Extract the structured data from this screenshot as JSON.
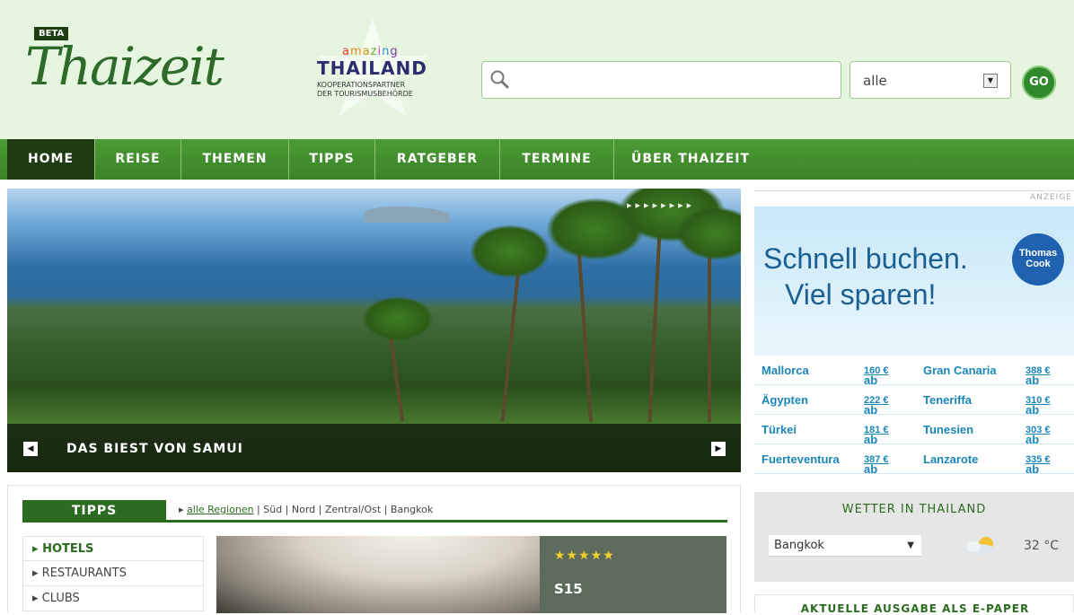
{
  "header": {
    "beta": "BETA",
    "logo": "Thaizeit",
    "amazing": {
      "letters": [
        {
          "ch": "a",
          "color": "#e53a2f"
        },
        {
          "ch": "m",
          "color": "#f08c1d"
        },
        {
          "ch": "a",
          "color": "#c49a12"
        },
        {
          "ch": "z",
          "color": "#6aa82c"
        },
        {
          "ch": "i",
          "color": "#e53a8f"
        },
        {
          "ch": "n",
          "color": "#2b8fd0"
        },
        {
          "ch": "g",
          "color": "#7b3aa6"
        }
      ],
      "thailand": "THAILAND",
      "coop_line1": "KOOPERATIONSPARTNER",
      "coop_line2": "DER TOURISMUSBEHÖRDE"
    },
    "search": {
      "value": "",
      "placeholder": ""
    },
    "region_select": "alle",
    "go": "GO"
  },
  "nav": {
    "items": [
      {
        "label": "HOME",
        "active": true
      },
      {
        "label": "REISE"
      },
      {
        "label": "THEMEN"
      },
      {
        "label": "TIPPS"
      },
      {
        "label": "RATGEBER"
      },
      {
        "label": "TERMINE"
      },
      {
        "label": "ÜBER THAIZEIT"
      }
    ]
  },
  "hero": {
    "caption": "DAS BIEST VON SAMUI",
    "prev": "◀",
    "next": "▶",
    "dots": "▸▸▸▸▸▸▸▸"
  },
  "ad": {
    "label": "ANZEIGE",
    "line1": "Schnell buchen.",
    "line2": "Viel sparen!",
    "brand1": "Thomas",
    "brand2": "Cook",
    "rows": [
      {
        "a": "Mallorca",
        "pa": "160 €",
        "b": "Gran Canaria",
        "pb": "388 €"
      },
      {
        "a": "Ägypten",
        "pa": "222 €",
        "b": "Teneriffa",
        "pb": "310 €"
      },
      {
        "a": "Türkei",
        "pa": "181 €",
        "b": "Tunesien",
        "pb": "303 €"
      },
      {
        "a": "Fuerteventura",
        "pa": "387 €",
        "b": "Lanzarote",
        "pb": "335 €"
      }
    ],
    "ab": "ab"
  },
  "tipps": {
    "title": "TIPPS",
    "regions": [
      "alle Regionen",
      "Süd",
      "Nord",
      "Zentral/Ost",
      "Bangkok"
    ],
    "side": [
      "HOTELS",
      "RESTAURANTS",
      "CLUBS"
    ],
    "stars": "★★★★★",
    "hotel": "S15"
  },
  "weather": {
    "title": "WETTER IN THAILAND",
    "city": "Bangkok",
    "temp": "32 °C"
  },
  "epaper": {
    "title": "AKTUELLE AUSGABE ALS E-PAPER"
  }
}
